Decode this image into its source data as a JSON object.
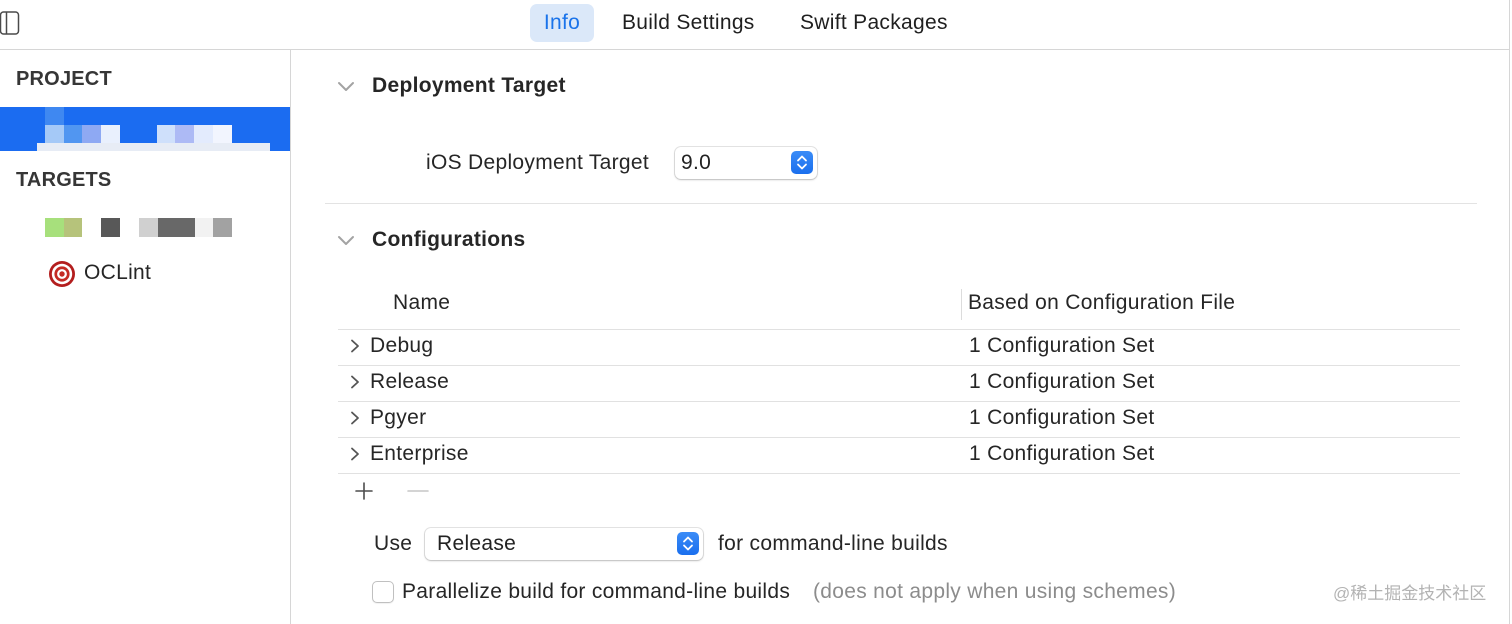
{
  "editor_tabs": [
    {
      "label": "Info",
      "selected": true
    },
    {
      "label": "Build Settings",
      "selected": false
    },
    {
      "label": "Swift Packages",
      "selected": false
    }
  ],
  "sidebar": {
    "project_header": "PROJECT",
    "project": {
      "name_obscured": true,
      "selected": true
    },
    "targets_header": "TARGETS",
    "targets": [
      {
        "name_obscured": true,
        "selected": false
      },
      {
        "label": "OCLint",
        "icon": "target-icon",
        "selected": false
      }
    ]
  },
  "deployment_target": {
    "title": "Deployment Target",
    "expanded": true,
    "ios_label": "iOS Deployment Target",
    "ios_value": "9.0"
  },
  "configurations": {
    "title": "Configurations",
    "expanded": true,
    "columns": {
      "name": "Name",
      "based_on": "Based on Configuration File"
    },
    "rows": [
      {
        "name": "Debug",
        "based_on": "1 Configuration Set",
        "expanded": false
      },
      {
        "name": "Release",
        "based_on": "1 Configuration Set",
        "expanded": false
      },
      {
        "name": "Pgyer",
        "based_on": "1 Configuration Set",
        "expanded": false
      },
      {
        "name": "Enterprise",
        "based_on": "1 Configuration Set",
        "expanded": false
      }
    ],
    "add_enabled": true,
    "remove_enabled": false,
    "use_label": "Use",
    "command_line_configuration": "Release",
    "command_line_suffix": "for command-line builds",
    "parallelize": {
      "checked": false,
      "label": "Parallelize build for command-line builds",
      "note": "(does not apply when using schemes)"
    }
  },
  "watermark": "@稀土掘金技术社区",
  "icons": {
    "sidebar_toggle": "sidebar-toggle-icon",
    "section_disclosure": "chevron-down-icon",
    "row_disclosure": "chevron-right-icon",
    "popup_stepper": "up-down-chevron-icon",
    "add": "plus-icon",
    "remove": "minus-icon",
    "target": "target-icon"
  },
  "colors": {
    "accent": "#1a6fee",
    "accent_light": "#3b8cf7",
    "selection": "#1b6cf1",
    "tab_selected_bg": "#dbe8f9",
    "tab_selected_text": "#1a73ea"
  }
}
